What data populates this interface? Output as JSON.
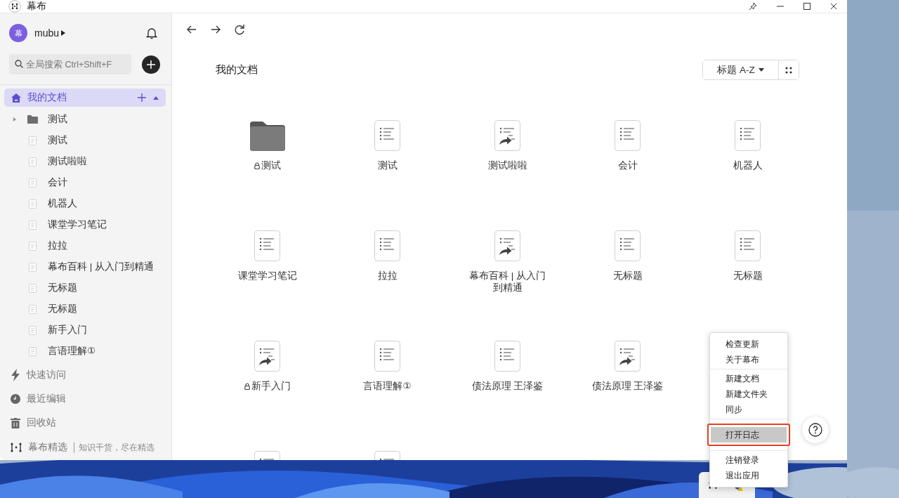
{
  "window": {
    "title": "幕布"
  },
  "sidebar": {
    "user": {
      "avatar": "幕",
      "name": "mubu"
    },
    "search": {
      "placeholder": "全局搜索 Ctrl+Shift+F"
    },
    "root": {
      "label": "我的文档",
      "selected": true,
      "expanded": true
    },
    "tree": [
      {
        "kind": "folder",
        "label": "测试",
        "expanded": false
      },
      {
        "kind": "doc",
        "label": "测试"
      },
      {
        "kind": "doc",
        "label": "测试啦啦"
      },
      {
        "kind": "doc",
        "label": "会计"
      },
      {
        "kind": "doc",
        "label": "机器人"
      },
      {
        "kind": "doc",
        "label": "课堂学习笔记"
      },
      {
        "kind": "doc",
        "label": "拉拉"
      },
      {
        "kind": "doc",
        "label": "幕布百科 | 从入门到精通"
      },
      {
        "kind": "doc",
        "label": "无标题"
      },
      {
        "kind": "doc",
        "label": "无标题"
      },
      {
        "kind": "doc",
        "label": "新手入门"
      },
      {
        "kind": "doc",
        "label": "言语理解①"
      }
    ],
    "nav": [
      {
        "kind": "quick",
        "label": "快速访问"
      },
      {
        "kind": "recent",
        "label": "最近编辑"
      },
      {
        "kind": "trash",
        "label": "回收站"
      }
    ],
    "footer": {
      "title": "幕布精选",
      "tagline": "知识干货，尽在精选"
    }
  },
  "main": {
    "heading": "我的文档",
    "sort": "标题 A-Z",
    "rows": [
      [
        {
          "kind": "folder",
          "name": "测试",
          "locked": true
        },
        {
          "kind": "doc",
          "name": "测试",
          "locked": false
        },
        {
          "kind": "shared",
          "name": "测试啦啦",
          "locked": false
        },
        {
          "kind": "doc",
          "name": "会计",
          "locked": false
        },
        {
          "kind": "doc",
          "name": "机器人",
          "locked": false
        }
      ],
      [
        {
          "kind": "doc",
          "name": "课堂学习笔记",
          "locked": false
        },
        {
          "kind": "doc",
          "name": "拉拉",
          "locked": false
        },
        {
          "kind": "shared",
          "name": "幕布百科 | 从入门到精通",
          "locked": false
        },
        {
          "kind": "doc",
          "name": "无标题",
          "locked": false
        },
        {
          "kind": "doc",
          "name": "无标题",
          "locked": false
        }
      ],
      [
        {
          "kind": "shared",
          "name": "新手入门",
          "locked": true
        },
        {
          "kind": "doc",
          "name": "言语理解①",
          "locked": false
        },
        {
          "kind": "doc",
          "name": "债法原理 王泽鉴",
          "locked": false
        },
        {
          "kind": "shared",
          "name": "债法原理 王泽鉴",
          "locked": false
        }
      ],
      [
        {
          "kind": "doc"
        },
        {
          "kind": "doc"
        }
      ]
    ]
  },
  "menu": {
    "groups": [
      [
        {
          "label": "检查更新",
          "selected": false
        },
        {
          "label": "关于幕布",
          "selected": false
        }
      ],
      [
        {
          "label": "新建文档",
          "selected": false
        },
        {
          "label": "新建文件夹",
          "selected": false
        },
        {
          "label": "同步",
          "selected": false
        }
      ],
      [
        {
          "label": "打开日志",
          "selected": true
        }
      ],
      [
        {
          "label": "注销登录",
          "selected": false
        },
        {
          "label": "退出应用",
          "selected": false
        }
      ]
    ]
  }
}
